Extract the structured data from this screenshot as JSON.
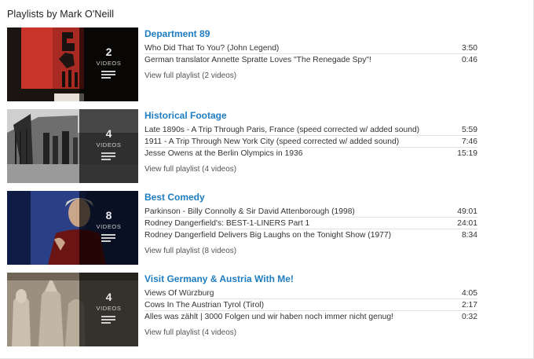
{
  "page": {
    "heading": "Playlists by Mark O'Neill"
  },
  "colors": {
    "link": "#1e7cc1",
    "overlay": "rgba(0,0,0,0.66)"
  },
  "playlists": [
    {
      "title": "Department 89",
      "count": "2",
      "videos_word": "VIDEOS",
      "videos": [
        {
          "title": "Who Did That To You? (John Legend)",
          "duration": "3:50"
        },
        {
          "title": "German translator Annette Spratte Loves \"The Renegade Spy\"!",
          "duration": "0:46"
        }
      ],
      "view_full": "View full playlist (2 videos)"
    },
    {
      "title": "Historical Footage",
      "count": "4",
      "videos_word": "VIDEOS",
      "videos": [
        {
          "title": "Late 1890s - A Trip Through Paris, France (speed corrected w/ added sound)",
          "duration": "5:59"
        },
        {
          "title": "1911 - A Trip Through New York City (speed corrected w/ added sound)",
          "duration": "7:46"
        },
        {
          "title": "Jesse Owens at the Berlin Olympics in 1936",
          "duration": "15:19"
        }
      ],
      "view_full": "View full playlist (4 videos)"
    },
    {
      "title": "Best Comedy",
      "count": "8",
      "videos_word": "VIDEOS",
      "videos": [
        {
          "title": "Parkinson - Billy Connolly & Sir David Attenborough (1998)",
          "duration": "49:01"
        },
        {
          "title": "Rodney Dangerfield's: BEST-1-LINERS Part 1",
          "duration": "24:01"
        },
        {
          "title": "Rodney Dangerfield Delivers Big Laughs on the Tonight Show (1977)",
          "duration": "8:34"
        }
      ],
      "view_full": "View full playlist (8 videos)"
    },
    {
      "title": "Visit Germany & Austria With Me!",
      "count": "4",
      "videos_word": "VIDEOS",
      "videos": [
        {
          "title": "Views Of Würzburg",
          "duration": "4:05"
        },
        {
          "title": "Cows In The Austrian Tyrol (Tirol)",
          "duration": "2:17"
        },
        {
          "title": "Alles was zählt | 3000 Folgen und wir haben noch immer nicht genug!",
          "duration": "0:32"
        }
      ],
      "view_full": "View full playlist (4 videos)"
    }
  ]
}
